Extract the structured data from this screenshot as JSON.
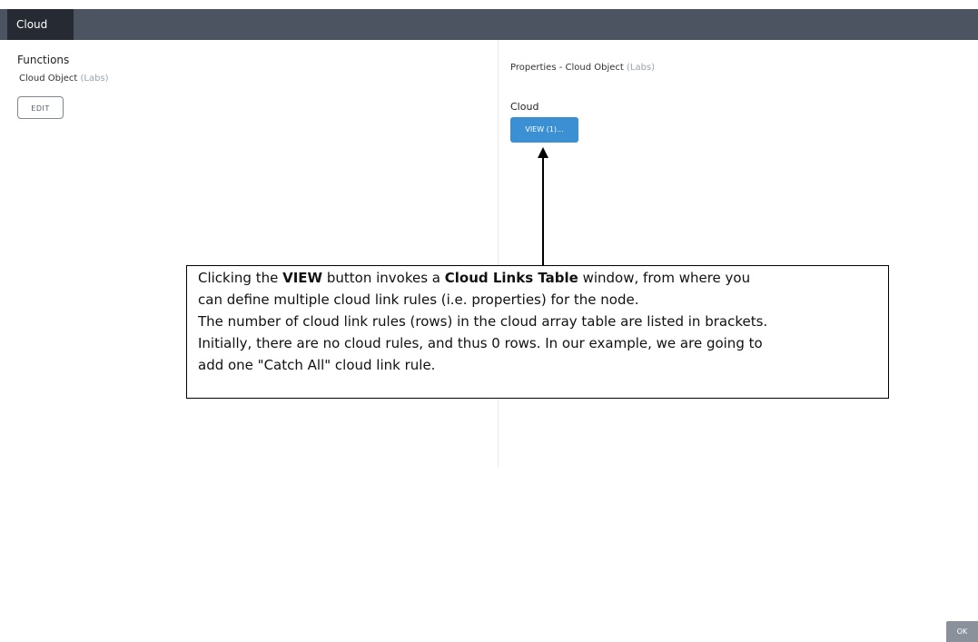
{
  "tabs": [
    {
      "label": "Cloud",
      "active": true
    }
  ],
  "functions": {
    "heading": "Functions",
    "item_name": "Cloud Object",
    "item_tag": "(Labs)",
    "edit_label": "EDIT"
  },
  "properties": {
    "title_prefix": "Properties  - Cloud Object",
    "title_tag": "(Labs)",
    "cloud_label": "Cloud",
    "view_label": "VIEW (1)..."
  },
  "callout": {
    "l1_a": "Clicking the ",
    "l1_b": "VIEW",
    "l1_c": " button invokes a ",
    "l1_d": "Cloud Links Table",
    "l1_e": " window, from where you",
    "l2": "can define multiple cloud link rules (i.e. properties) for the node.",
    "l3": "The number of cloud link rules (rows) in the cloud array table are listed in brackets.",
    "l4": "Initially, there are no cloud rules, and thus 0 rows. In our example, we are going to",
    "l5": "add one \"Catch All\" cloud link rule."
  },
  "footer": {
    "ok_label": "OK"
  },
  "colors": {
    "tabbar": "#4d5461",
    "active_tab": "#262b33",
    "view_button": "#3b8fd3",
    "ok_button": "#8a919b",
    "labs_tag": "#9aa3ae"
  },
  "icons": {
    "callout_arrow": "arrow-up-icon"
  }
}
